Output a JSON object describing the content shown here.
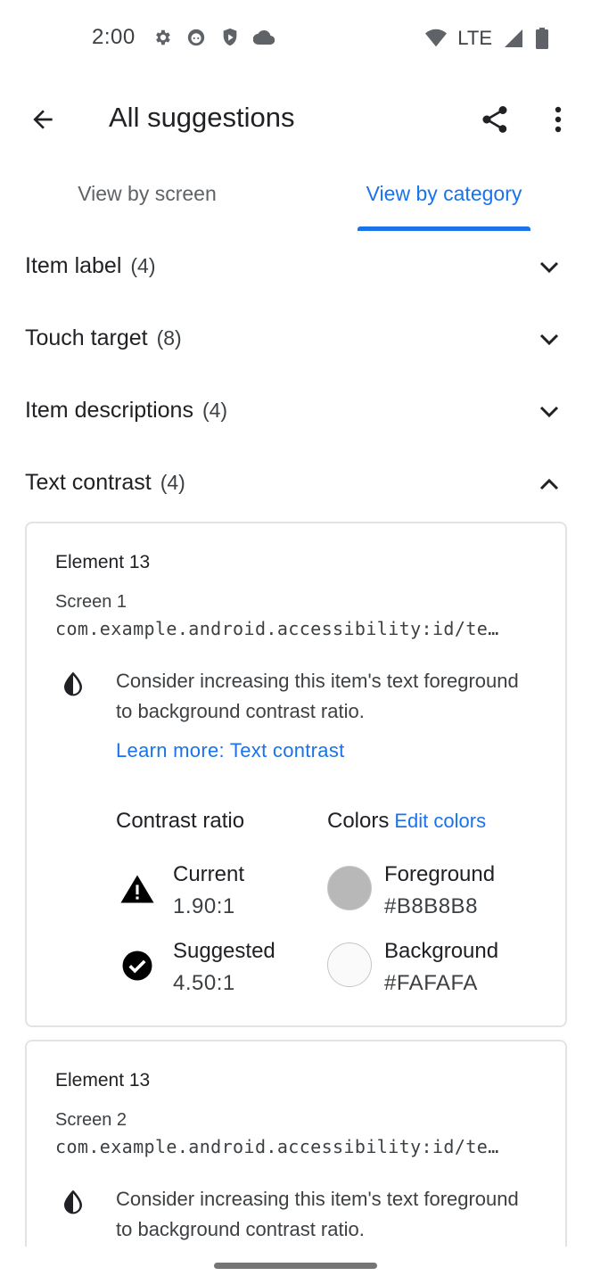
{
  "status_bar": {
    "time": "2:00",
    "network": "LTE",
    "icons_left": [
      "settings-icon",
      "android-icon",
      "shield-icon",
      "cloud-icon"
    ],
    "icons_right": [
      "wifi-icon",
      "signal-icon",
      "battery-icon"
    ]
  },
  "app_bar": {
    "title": "All suggestions",
    "back_icon": "arrow-back-icon",
    "share_icon": "share-icon",
    "overflow_icon": "more-vert-icon"
  },
  "tabs": {
    "items": [
      "View by screen",
      "View by category"
    ],
    "selected": "View by category",
    "accent": "#1a73e8"
  },
  "categories": [
    {
      "label": "Item label",
      "count": "(4)",
      "expanded": false
    },
    {
      "label": "Touch target",
      "count": "(8)",
      "expanded": false
    },
    {
      "label": "Item descriptions",
      "count": "(4)",
      "expanded": false
    },
    {
      "label": "Text contrast",
      "count": "(4)",
      "expanded": true
    }
  ],
  "cards": [
    {
      "title": "Element 13",
      "screen": "Screen 1",
      "resource_id": "com.example.android.accessibility:id/te…",
      "message": "Consider increasing this item's text foreground to background contrast ratio.",
      "learn_more": "Learn more: Text contrast",
      "contrast_heading": "Contrast ratio",
      "colors_heading": "Colors",
      "edit_colors": "Edit colors",
      "current_label": "Current",
      "current_value": "1.90:1",
      "suggested_label": "Suggested",
      "suggested_value": "4.50:1",
      "foreground_label": "Foreground",
      "foreground_value": "#B8B8B8",
      "background_label": "Background",
      "background_value": "#FAFAFA",
      "foreground_color": "#B8B8B8",
      "background_color": "#FAFAFA"
    },
    {
      "title": "Element 13",
      "screen": "Screen 2",
      "resource_id": "com.example.android.accessibility:id/te…",
      "message": "Consider increasing this item's text foreground to background contrast ratio."
    }
  ]
}
